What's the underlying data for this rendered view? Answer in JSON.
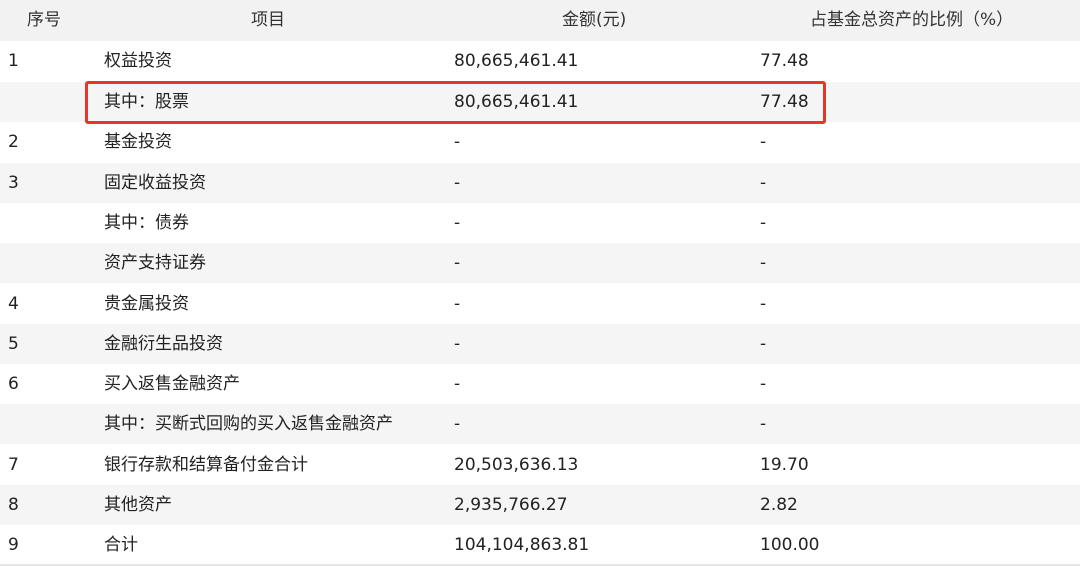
{
  "header": {
    "no": "序号",
    "item": "项目",
    "amount": "金额(元)",
    "ratio": "占基金总资产的比例（%）"
  },
  "rows": [
    {
      "no": "1",
      "item": "权益投资",
      "amount": "80,665,461.41",
      "ratio": "77.48"
    },
    {
      "no": "",
      "item": "其中：股票",
      "amount": "80,665,461.41",
      "ratio": "77.48"
    },
    {
      "no": "2",
      "item": "基金投资",
      "amount": "-",
      "ratio": "-"
    },
    {
      "no": "3",
      "item": "固定收益投资",
      "amount": "-",
      "ratio": "-"
    },
    {
      "no": "",
      "item": "其中：债券",
      "amount": "-",
      "ratio": "-"
    },
    {
      "no": "",
      "item": "资产支持证券",
      "amount": "-",
      "ratio": "-"
    },
    {
      "no": "4",
      "item": "贵金属投资",
      "amount": "-",
      "ratio": "-"
    },
    {
      "no": "5",
      "item": "金融衍生品投资",
      "amount": "-",
      "ratio": "-"
    },
    {
      "no": "6",
      "item": "买入返售金融资产",
      "amount": "-",
      "ratio": "-"
    },
    {
      "no": "",
      "item": "其中：买断式回购的买入返售金融资产",
      "amount": "-",
      "ratio": "-"
    },
    {
      "no": "7",
      "item": "银行存款和结算备付金合计",
      "amount": "20,503,636.13",
      "ratio": "19.70"
    },
    {
      "no": "8",
      "item": "其他资产",
      "amount": "2,935,766.27",
      "ratio": "2.82"
    },
    {
      "no": "9",
      "item": "合计",
      "amount": "104,104,863.81",
      "ratio": "100.00"
    }
  ],
  "colors": {
    "highlight": "#e8342c",
    "header_bg": "#f2f2f3",
    "alt_row_bg": "#f5f5f6"
  }
}
